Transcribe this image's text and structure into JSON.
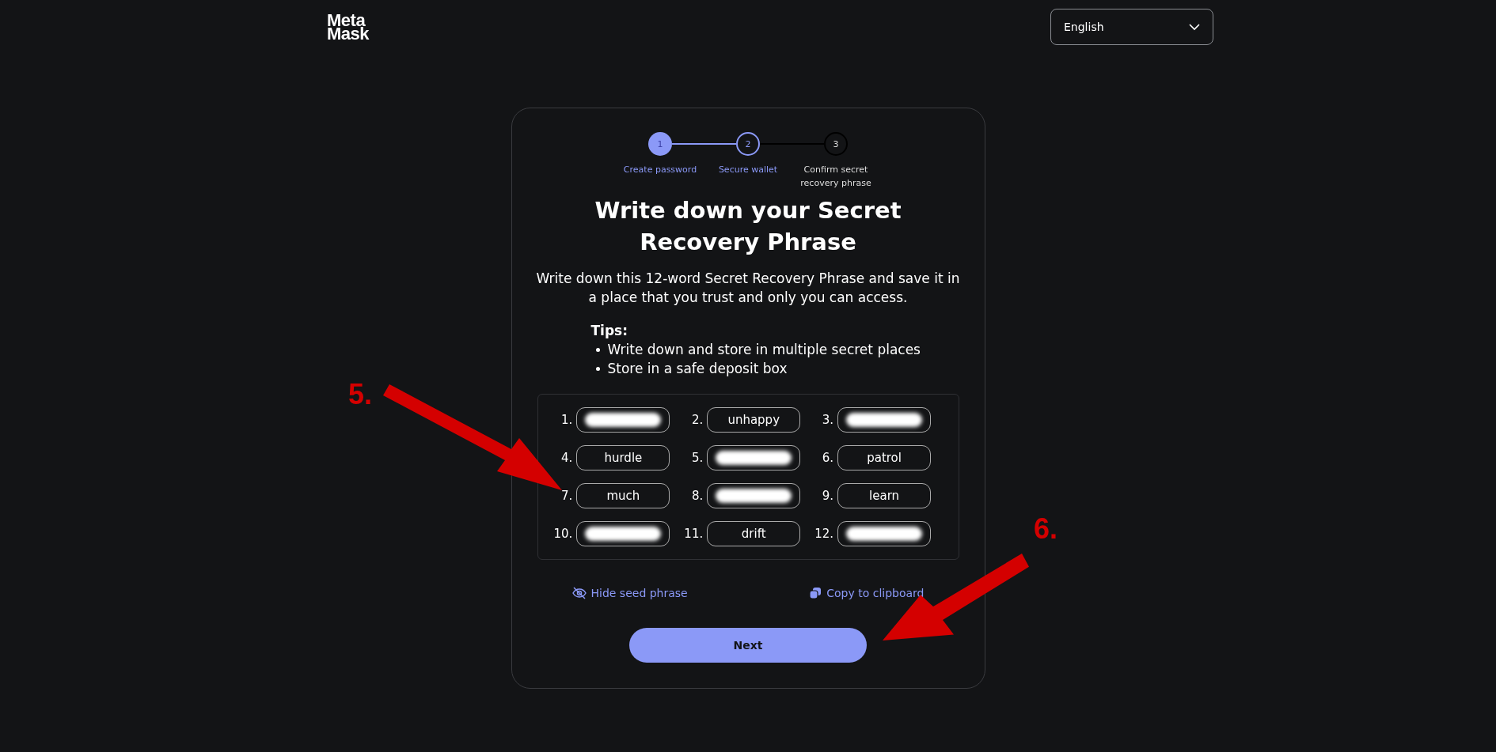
{
  "header": {
    "logo": [
      "Meta",
      "Mask"
    ],
    "language": {
      "value": "English"
    }
  },
  "stepper": [
    {
      "number": "1",
      "label": "Create password",
      "completed": true,
      "selected": false
    },
    {
      "number": "2",
      "label": "Secure wallet",
      "completed": false,
      "selected": true
    },
    {
      "number": "3",
      "label": "Confirm secret recovery phrase",
      "completed": false,
      "selected": false
    }
  ],
  "title": "Write down your Secret Recovery Phrase",
  "description": "Write down this 12-word Secret Recovery Phrase and save it in a place that you trust and only you can access.",
  "tips": {
    "heading": "Tips:",
    "items": [
      "Write down and store in multiple secret places",
      "Store in a safe deposit box"
    ]
  },
  "words": [
    {
      "index": "1.",
      "kind": "blurred"
    },
    {
      "index": "2.",
      "kind": "word",
      "text": "unhappy"
    },
    {
      "index": "3.",
      "kind": "blurred"
    },
    {
      "index": "4.",
      "kind": "word",
      "text": "hurdle"
    },
    {
      "index": "5.",
      "kind": "blurred"
    },
    {
      "index": "6.",
      "kind": "word",
      "text": "patrol"
    },
    {
      "index": "7.",
      "kind": "word",
      "text": "much"
    },
    {
      "index": "8.",
      "kind": "blurred"
    },
    {
      "index": "9.",
      "kind": "word",
      "text": "learn"
    },
    {
      "index": "10.",
      "kind": "blurred"
    },
    {
      "index": "11.",
      "kind": "word",
      "text": "drift"
    },
    {
      "index": "12.",
      "kind": "blurred"
    }
  ],
  "actions": {
    "hide": "Hide seed phrase",
    "copy": "Copy to clipboard"
  },
  "next_button": "Next",
  "annotations": [
    {
      "label": "5."
    },
    {
      "label": "6."
    }
  ]
}
